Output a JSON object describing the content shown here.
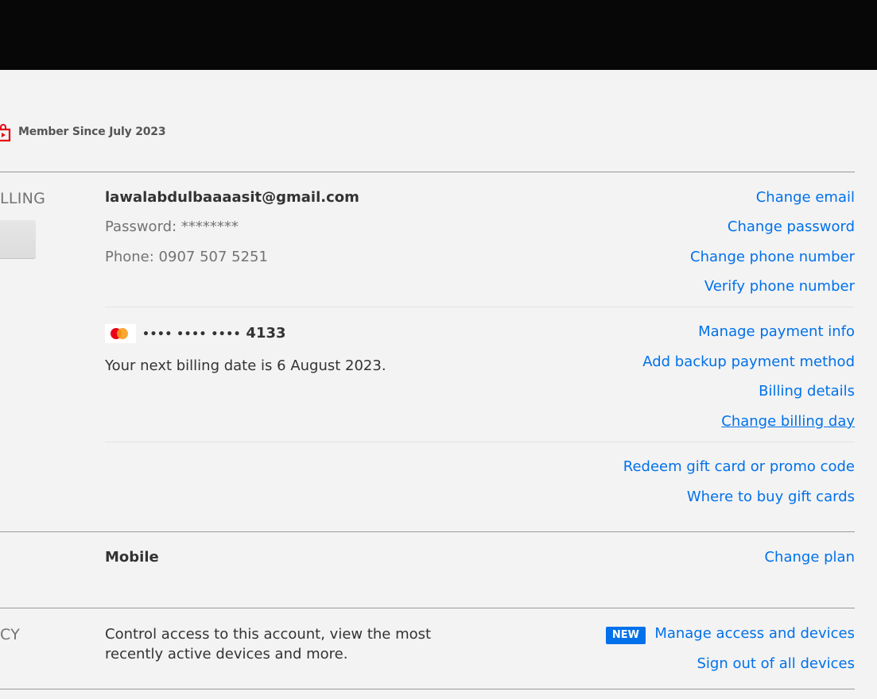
{
  "header": {
    "background": "#070708"
  },
  "member": {
    "icon": "member-since-icon",
    "label": "Member Since July 2023"
  },
  "billing": {
    "section_label": "LLING",
    "email": "lawalabdulbaaaasit@gmail.com",
    "password": "Password: ********",
    "phone": "Phone: 0907 507 5251",
    "links_account": [
      "Change email",
      "Change password",
      "Change phone number",
      "Verify phone number"
    ],
    "card_brand": "mastercard-icon",
    "card_dots": "•••• •••• ••••",
    "card_last4": "4133",
    "next_billing": "Your next billing date is 6 August 2023.",
    "links_payment": [
      "Manage payment info",
      "Add backup payment method",
      "Billing details",
      "Change billing day"
    ],
    "links_gift": [
      "Redeem gift card or promo code",
      "Where to buy gift cards"
    ]
  },
  "plan": {
    "name": "Mobile",
    "change_link": "Change plan"
  },
  "security": {
    "section_label": "CY",
    "description": "Control access to this account, view the most recently active devices and more.",
    "badge": "NEW",
    "links": [
      "Manage access and devices",
      "Sign out of all devices"
    ]
  },
  "colors": {
    "link": "#0071eb",
    "brand_red": "#e50914",
    "badge": "#0071eb"
  }
}
